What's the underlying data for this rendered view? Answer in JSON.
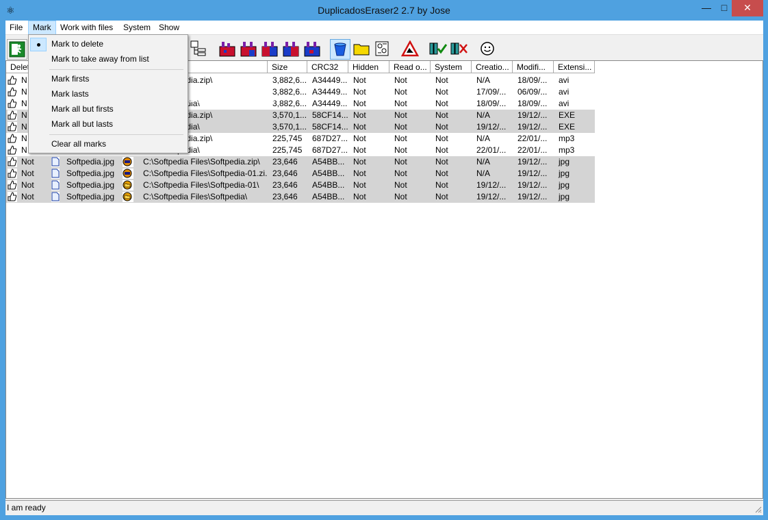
{
  "window": {
    "title": "DuplicadosEraser2 2.7 by Jose"
  },
  "menubar": {
    "items": [
      "File",
      "Mark",
      "Work with files",
      "System",
      "Show"
    ],
    "active": "Mark"
  },
  "mark_menu": {
    "items": [
      {
        "label": "Mark to delete",
        "checked": true
      },
      {
        "label": "Mark to take away from list"
      },
      {
        "label": "Mark firsts"
      },
      {
        "label": "Mark lasts"
      },
      {
        "label": "Mark all but firsts"
      },
      {
        "label": "Mark all but lasts"
      },
      {
        "label": "Clear all marks"
      }
    ]
  },
  "grid": {
    "columns": [
      "Delet",
      "",
      "",
      "Size",
      "CRC32",
      "Hidden",
      "Read o...",
      "System",
      "Creatio...",
      "Modifi...",
      "Extensi..."
    ],
    "rows": [
      {
        "delete": "N",
        "name": "",
        "path": "Files\\Softpedia.zip\\",
        "size": "3,882,6...",
        "crc": "A34449...",
        "hidden": "Not",
        "readonly": "Not",
        "system": "Not",
        "created": "N/A",
        "modified": "18/09/...",
        "ext": "avi",
        "gray": false
      },
      {
        "delete": "N",
        "name": "",
        "path": "Files\\",
        "size": "3,882,6...",
        "crc": "A34449...",
        "hidden": "Not",
        "readonly": "Not",
        "system": "Not",
        "created": "17/09/...",
        "modified": "06/09/...",
        "ext": "avi",
        "gray": false
      },
      {
        "delete": "N",
        "name": "",
        "path": "Files\\Softpedia\\",
        "size": "3,882,6...",
        "crc": "A34449...",
        "hidden": "Not",
        "readonly": "Not",
        "system": "Not",
        "created": "18/09/...",
        "modified": "18/09/...",
        "ext": "avi",
        "gray": false
      },
      {
        "delete": "N",
        "name": "",
        "path": "Files\\Softpedia.zip\\",
        "size": "3,570,1...",
        "crc": "58CF14...",
        "hidden": "Not",
        "readonly": "Not",
        "system": "Not",
        "created": "N/A",
        "modified": "19/12/...",
        "ext": "EXE",
        "gray": true
      },
      {
        "delete": "N",
        "name": "",
        "path": "Files\\Softpedia\\",
        "size": "3,570,1...",
        "crc": "58CF14...",
        "hidden": "Not",
        "readonly": "Not",
        "system": "Not",
        "created": "19/12/...",
        "modified": "19/12/...",
        "ext": "EXE",
        "gray": true
      },
      {
        "delete": "N",
        "name": "",
        "path": "Files\\Softpedia.zip\\",
        "size": "225,745",
        "crc": "687D27...",
        "hidden": "Not",
        "readonly": "Not",
        "system": "Not",
        "created": "N/A",
        "modified": "22/01/...",
        "ext": "mp3",
        "gray": false
      },
      {
        "delete": "N",
        "name": "",
        "path": "Files\\Softpedia\\",
        "size": "225,745",
        "crc": "687D27...",
        "hidden": "Not",
        "readonly": "Not",
        "system": "Not",
        "created": "22/01/...",
        "modified": "22/01/...",
        "ext": "mp3",
        "gray": false
      },
      {
        "delete": "Not",
        "name": "Softpedia.jpg",
        "path": "C:\\Softpedia Files\\Softpedia.zip\\",
        "size": "23,646",
        "crc": "A54BB...",
        "hidden": "Not",
        "readonly": "Not",
        "system": "Not",
        "created": "N/A",
        "modified": "19/12/...",
        "ext": "jpg",
        "gray": true,
        "icon": "zip"
      },
      {
        "delete": "Not",
        "name": "Softpedia.jpg",
        "path": "C:\\Softpedia Files\\Softpedia-01.zi...",
        "size": "23,646",
        "crc": "A54BB...",
        "hidden": "Not",
        "readonly": "Not",
        "system": "Not",
        "created": "N/A",
        "modified": "19/12/...",
        "ext": "jpg",
        "gray": true,
        "icon": "zip"
      },
      {
        "delete": "Not",
        "name": "Softpedia.jpg",
        "path": "C:\\Softpedia Files\\Softpedia-01\\",
        "size": "23,646",
        "crc": "A54BB...",
        "hidden": "Not",
        "readonly": "Not",
        "system": "Not",
        "created": "19/12/...",
        "modified": "19/12/...",
        "ext": "jpg",
        "gray": true,
        "icon": "folder"
      },
      {
        "delete": "Not",
        "name": "Softpedia.jpg",
        "path": "C:\\Softpedia Files\\Softpedia\\",
        "size": "23,646",
        "crc": "A54BB...",
        "hidden": "Not",
        "readonly": "Not",
        "system": "Not",
        "created": "19/12/...",
        "modified": "19/12/...",
        "ext": "jpg",
        "gray": true,
        "icon": "folder"
      }
    ]
  },
  "status": {
    "text": "I am ready"
  },
  "colors": {
    "titlebar": "#4fa1e0",
    "close": "#c74d4d",
    "row_gray": "#d4d4d4",
    "menu_highlight": "#cce8ff"
  }
}
